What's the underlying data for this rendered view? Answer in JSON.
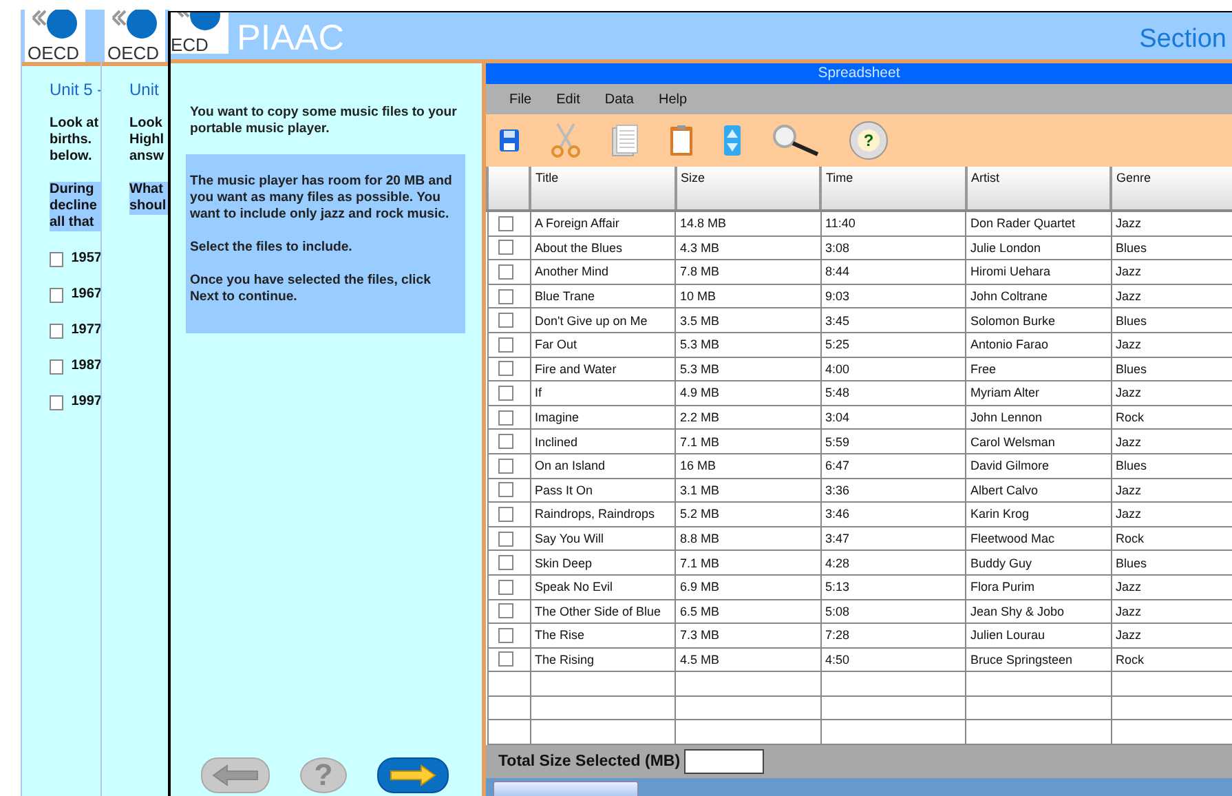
{
  "background_windows": [
    {
      "logo": "OECD",
      "unit": "Unit 5 -",
      "intro": [
        "Look at",
        "births.",
        "below."
      ],
      "question": [
        "During",
        "decline",
        "all that"
      ],
      "options": [
        {
          "label": "1957",
          "checked": false
        },
        {
          "label": "1967",
          "checked": false
        },
        {
          "label": "1977",
          "checked": false
        },
        {
          "label": "1987",
          "checked": false
        },
        {
          "label": "1997",
          "checked": false
        }
      ]
    },
    {
      "logo": "OECD",
      "unit": "Unit",
      "intro": [
        "Look",
        "Highl",
        "answ"
      ],
      "question": [
        "What",
        "shoul"
      ]
    }
  ],
  "header": {
    "logo": "ECD",
    "title": "PIAAC",
    "section": "Section"
  },
  "instructions": {
    "intro": "You want to copy some music files to your portable music player.",
    "box": [
      "The music player has room for 20 MB and you want as many files as possible. You want to include only jazz and rock music.",
      "Select the files to include.",
      "Once you have selected the files, click Next to continue."
    ]
  },
  "nav_buttons": [
    {
      "kind": "back",
      "disabled": true
    },
    {
      "kind": "help",
      "label": "?",
      "disabled": true
    },
    {
      "kind": "next",
      "disabled": false
    }
  ],
  "spreadsheet": {
    "title": "Spreadsheet",
    "menu": [
      "File",
      "Edit",
      "Data",
      "Help"
    ],
    "toolbar": [
      {
        "kind": "save"
      },
      {
        "kind": "cut"
      },
      {
        "kind": "copy"
      },
      {
        "kind": "paste"
      },
      {
        "kind": "sort"
      },
      {
        "kind": "search"
      },
      {
        "kind": "help",
        "label": "?"
      }
    ],
    "columns": [
      "Title",
      "Size",
      "Time",
      "Artist",
      "Genre"
    ],
    "rows": [
      {
        "checked": false,
        "cells": [
          "A Foreign Affair",
          "14.8 MB",
          "11:40",
          "Don Rader Quartet",
          "Jazz"
        ]
      },
      {
        "checked": false,
        "cells": [
          "About the Blues",
          "4.3 MB",
          "3:08",
          "Julie London",
          "Blues"
        ]
      },
      {
        "checked": false,
        "cells": [
          "Another Mind",
          "7.8 MB",
          "8:44",
          "Hiromi Uehara",
          "Jazz"
        ]
      },
      {
        "checked": false,
        "cells": [
          "Blue Trane",
          "10 MB",
          "9:03",
          "John Coltrane",
          "Jazz"
        ]
      },
      {
        "checked": false,
        "cells": [
          "Don't Give up on Me",
          "3.5 MB",
          "3:45",
          "Solomon Burke",
          "Blues"
        ]
      },
      {
        "checked": false,
        "cells": [
          "Far Out",
          "5.3 MB",
          "5:25",
          "Antonio Farao",
          "Jazz"
        ]
      },
      {
        "checked": false,
        "cells": [
          "Fire and Water",
          "5.3 MB",
          "4:00",
          "Free",
          "Blues"
        ]
      },
      {
        "checked": false,
        "cells": [
          "If",
          "4.9 MB",
          "5:48",
          "Myriam Alter",
          "Jazz"
        ]
      },
      {
        "checked": false,
        "cells": [
          "Imagine",
          "2.2 MB",
          "3:04",
          "John Lennon",
          "Rock"
        ]
      },
      {
        "checked": false,
        "cells": [
          "Inclined",
          "7.1 MB",
          "5:59",
          "Carol Welsman",
          "Jazz"
        ]
      },
      {
        "checked": false,
        "cells": [
          "On an Island",
          "16 MB",
          "6:47",
          "David Gilmore",
          "Blues"
        ]
      },
      {
        "checked": false,
        "cells": [
          "Pass It On",
          "3.1 MB",
          "3:36",
          "Albert Calvo",
          "Jazz"
        ]
      },
      {
        "checked": false,
        "cells": [
          "Raindrops, Raindrops",
          "5.2 MB",
          "3:46",
          "Karin Krog",
          "Jazz"
        ]
      },
      {
        "checked": false,
        "cells": [
          "Say You Will",
          "8.8 MB",
          "3:47",
          "Fleetwood Mac",
          "Rock"
        ]
      },
      {
        "checked": false,
        "cells": [
          "Skin Deep",
          "7.1 MB",
          "4:28",
          "Buddy Guy",
          "Blues"
        ]
      },
      {
        "checked": false,
        "cells": [
          "Speak No Evil",
          "6.9 MB",
          "5:13",
          "Flora Purim",
          "Jazz"
        ]
      },
      {
        "checked": false,
        "cells": [
          "The Other Side of Blue",
          "6.5 MB",
          "5:08",
          "Jean Shy & Jobo",
          "Jazz"
        ]
      },
      {
        "checked": false,
        "cells": [
          "The Rise",
          "7.3 MB",
          "7:28",
          "Julien Lourau",
          "Jazz"
        ]
      },
      {
        "checked": false,
        "cells": [
          "The Rising",
          "4.5 MB",
          "4:50",
          "Bruce Springsteen",
          "Rock"
        ]
      }
    ],
    "total_label": "Total Size Selected (MB)"
  }
}
